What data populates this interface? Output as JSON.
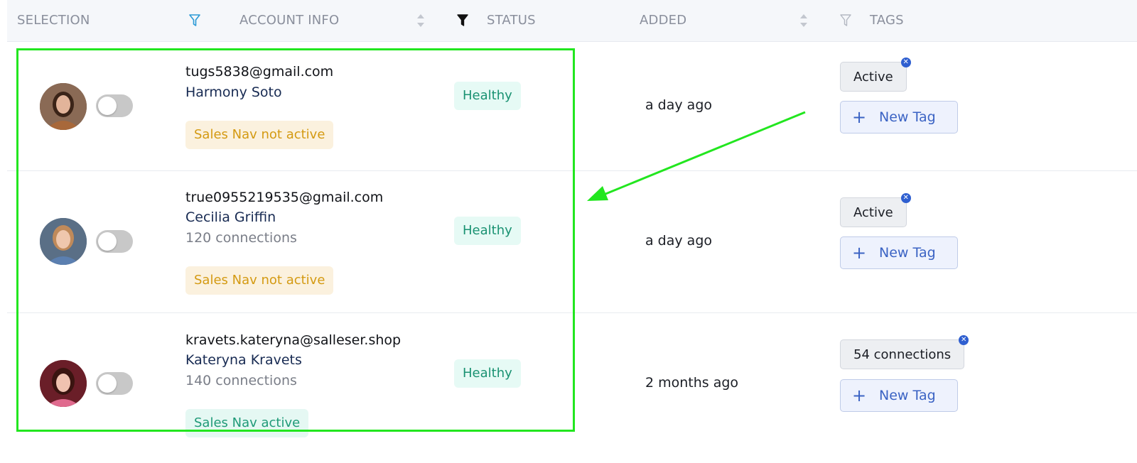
{
  "header": {
    "selection": "SELECTION",
    "account_info": "ACCOUNT INFO",
    "status": "STATUS",
    "added": "ADDED",
    "tags": "TAGS",
    "icons": {
      "account_filter": "filter-outline-icon",
      "status_filter": "filter-filled-icon",
      "tags_filter": "filter-outline-icon",
      "sort": "sort-icon"
    }
  },
  "rows": [
    {
      "email": "tugs5838@gmail.com",
      "name": "Harmony Soto",
      "connections": "",
      "sales_nav": "Sales Nav not active",
      "status": "Healthy",
      "added": "a day ago",
      "tag": "Active",
      "new_tag": "New Tag"
    },
    {
      "email": "true0955219535@gmail.com",
      "name": "Cecilia Griffin",
      "connections": "120 connections",
      "sales_nav": "Sales Nav not active",
      "status": "Healthy",
      "added": "a day ago",
      "tag": "Active",
      "new_tag": "New Tag"
    },
    {
      "email": "kravets.kateryna@salleser.shop",
      "name": "Kateryna Kravets",
      "connections": "140 connections",
      "sales_nav": "Sales Nav active",
      "status": "Healthy",
      "added": "2 months ago",
      "tag": "54 connections",
      "new_tag": "New Tag"
    }
  ],
  "colors": {
    "highlight": "#22e61f",
    "healthy": "#1a9272",
    "sales_nav_inactive": "#d49a12",
    "sales_nav_active": "#1f9a78",
    "new_tag": "#3b63c4",
    "tag_remove": "#2f5fd0"
  }
}
